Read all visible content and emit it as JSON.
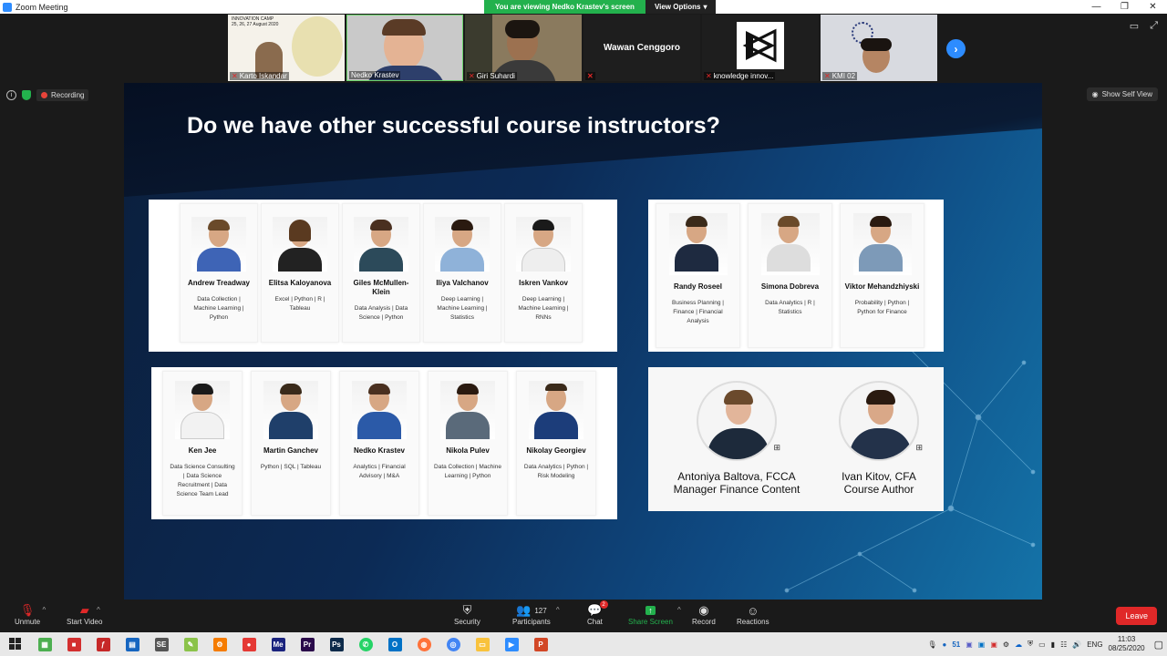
{
  "window": {
    "title": "Zoom Meeting"
  },
  "share": {
    "viewing": "You are viewing Nedko Krastev's screen",
    "options": "View Options"
  },
  "participants_strip": [
    {
      "name": "Karto Iskandar",
      "muted": true
    },
    {
      "name": "Nedko Krastev",
      "muted": false
    },
    {
      "name": "Giri Suhardi",
      "muted": true
    },
    {
      "name": "Wawan Cenggoro",
      "muted": true,
      "video_off": true
    },
    {
      "name": "knowledge innov...",
      "muted": true
    },
    {
      "name": "KMI 02",
      "muted": true
    }
  ],
  "status": {
    "recording": "Recording",
    "self_view": "Show Self View"
  },
  "slide": {
    "title": "Do we have other successful course instructors?",
    "panel1": [
      {
        "name": "Andrew Treadway",
        "tags": "Data Collection | Machine Learning | Python"
      },
      {
        "name": "Elitsa Kaloyanova",
        "tags": "Excel | Python | R | Tableau"
      },
      {
        "name": "Giles McMullen-Klein",
        "tags": "Data Analysis | Data Science | Python"
      },
      {
        "name": "Iliya Valchanov",
        "tags": "Deep Learning | Machine Learning | Statistics"
      },
      {
        "name": "Iskren Vankov",
        "tags": "Deep Learning | Machine Learning | RNNs"
      }
    ],
    "panel2": [
      {
        "name": "Randy Roseel",
        "tags": "Business Planning | Finance | Financial Analysis"
      },
      {
        "name": "Simona Dobreva",
        "tags": "Data Analytics | R | Statistics"
      },
      {
        "name": "Viktor Mehandzhiyski",
        "tags": "Probability | Python | Python for Finance"
      }
    ],
    "panel3": [
      {
        "name": "Ken Jee",
        "tags": "Data Science Consulting | Data Science Recruitment | Data Science Team Lead"
      },
      {
        "name": "Martin Ganchev",
        "tags": "Python | SQL | Tableau"
      },
      {
        "name": "Nedko Krastev",
        "tags": "Analytics | Financial Advisory | M&A"
      },
      {
        "name": "Nikola Pulev",
        "tags": "Data Collection | Machine Learning | Python"
      },
      {
        "name": "Nikolay Georgiev",
        "tags": "Data Analytics | Python | Risk Modeling"
      }
    ],
    "panel4": [
      {
        "line1": "Antoniya Baltova, FCCA",
        "line2": "Manager Finance Content"
      },
      {
        "line1": "Ivan Kitov, CFA",
        "line2": "Course Author"
      }
    ]
  },
  "toolbar": {
    "unmute": "Unmute",
    "start_video": "Start Video",
    "security": "Security",
    "participants": "Participants",
    "participants_count": "127",
    "chat": "Chat",
    "chat_badge": "2",
    "share_screen": "Share Screen",
    "record": "Record",
    "reactions": "Reactions",
    "leave": "Leave"
  },
  "taskbar": {
    "lang": "ENG",
    "notif_count": "51",
    "time": "11:03",
    "date": "08/25/2020"
  }
}
